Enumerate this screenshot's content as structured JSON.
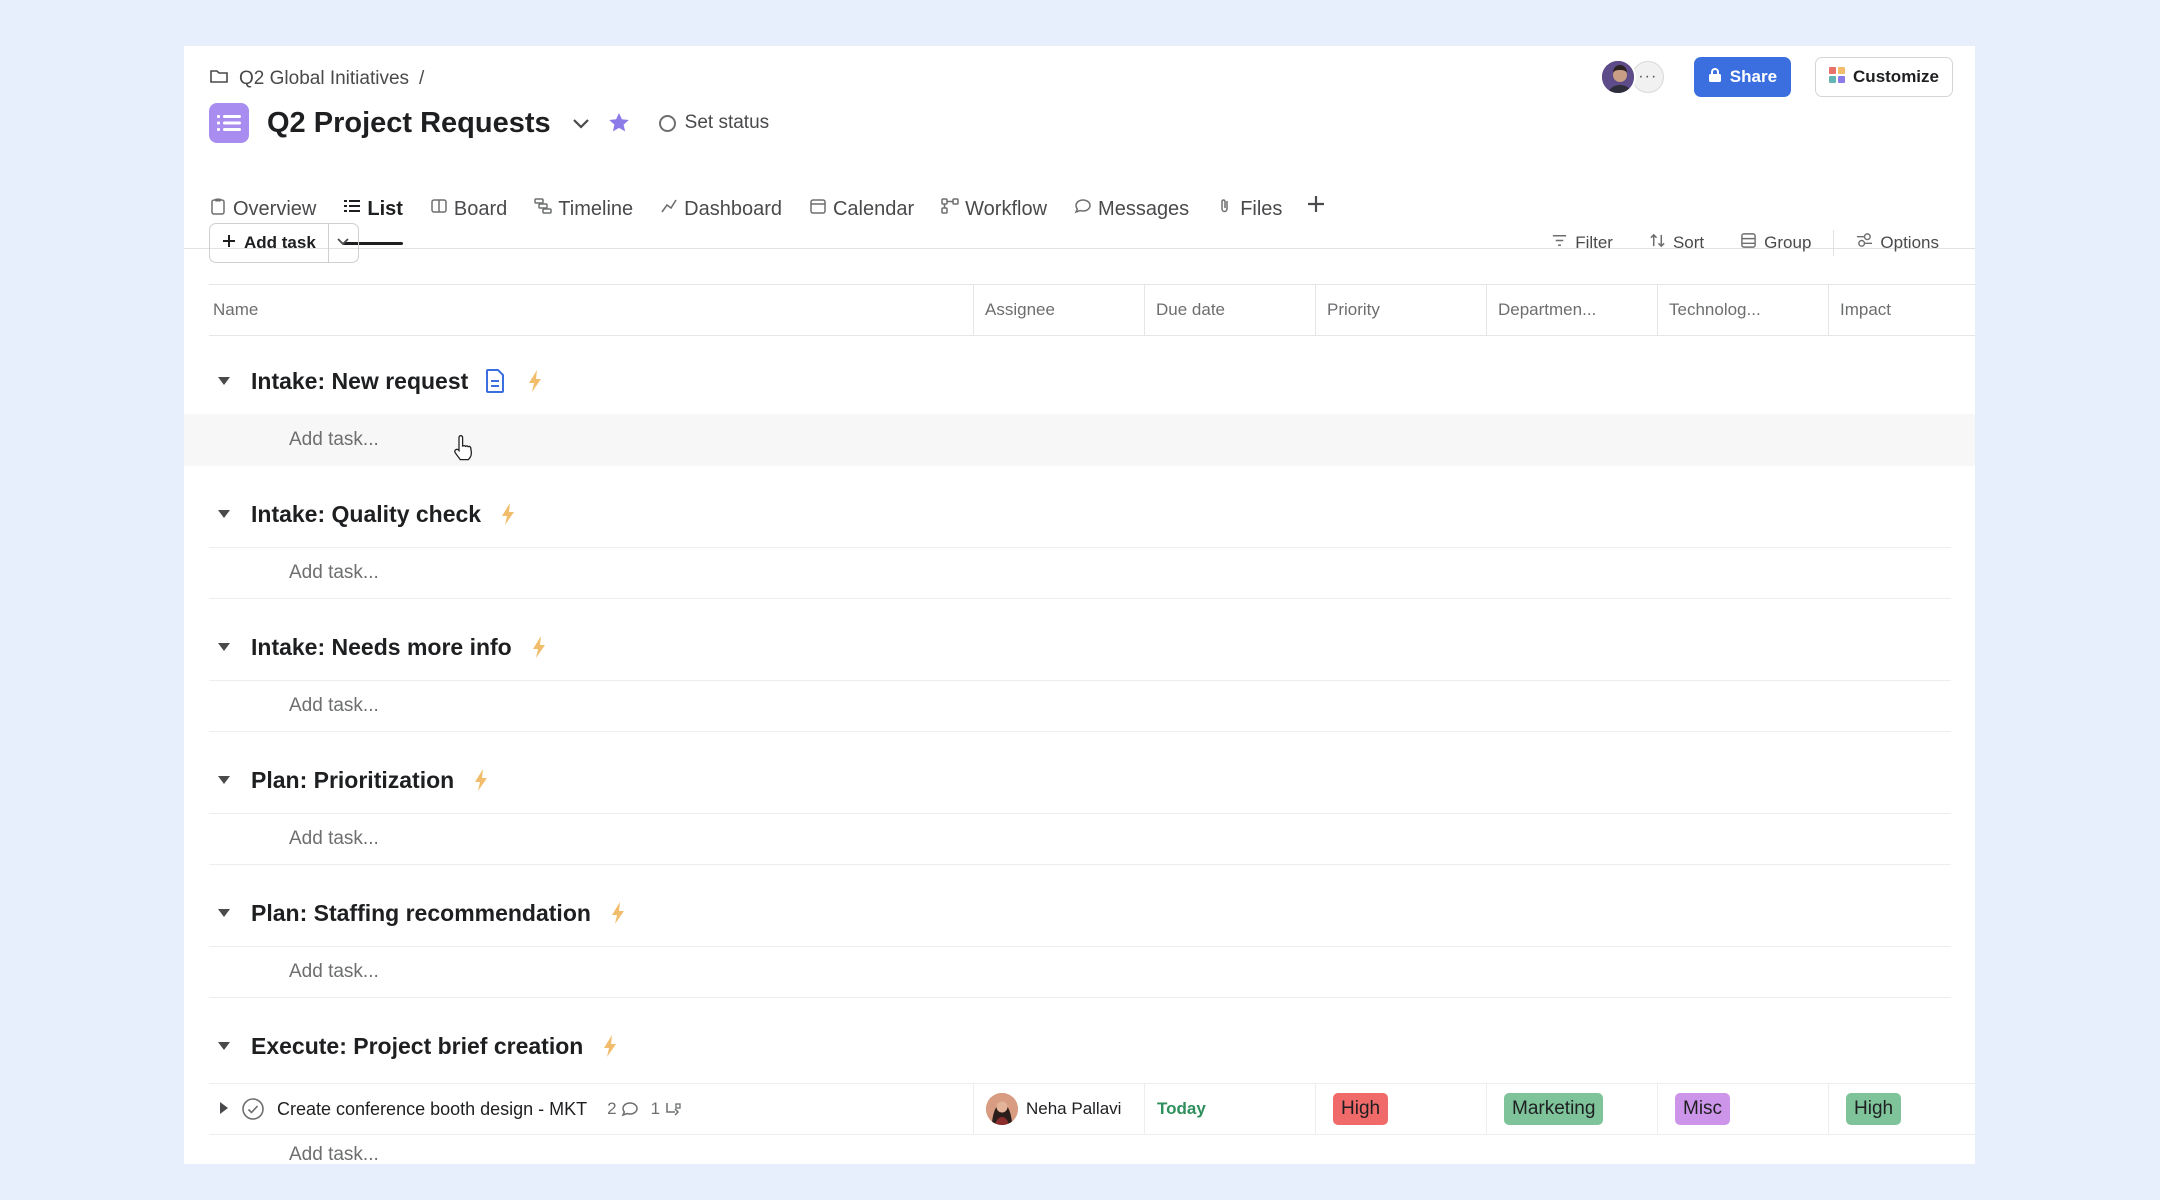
{
  "breadcrumb": {
    "parent": "Q2 Global Initiatives",
    "separator": "/"
  },
  "project": {
    "title": "Q2 Project Requests",
    "set_status": "Set status"
  },
  "header_actions": {
    "more_glyph": "···",
    "share": "Share",
    "customize": "Customize"
  },
  "tabs": [
    {
      "label": "Overview",
      "icon": "clipboard-icon"
    },
    {
      "label": "List",
      "icon": "list-icon",
      "active": true
    },
    {
      "label": "Board",
      "icon": "board-icon"
    },
    {
      "label": "Timeline",
      "icon": "timeline-icon"
    },
    {
      "label": "Dashboard",
      "icon": "dashboard-icon"
    },
    {
      "label": "Calendar",
      "icon": "calendar-icon"
    },
    {
      "label": "Workflow",
      "icon": "workflow-icon"
    },
    {
      "label": "Messages",
      "icon": "message-icon"
    },
    {
      "label": "Files",
      "icon": "paperclip-icon"
    }
  ],
  "toolbar": {
    "add_task": "Add task",
    "filter": "Filter",
    "sort": "Sort",
    "group": "Group",
    "options": "Options"
  },
  "columns": [
    "Name",
    "Assignee",
    "Due date",
    "Priority",
    "Departmen...",
    "Technolog...",
    "Impact"
  ],
  "sections": [
    {
      "title": "Intake: New request",
      "add_task": "Add task..."
    },
    {
      "title": "Intake: Quality check",
      "add_task": "Add task..."
    },
    {
      "title": "Intake: Needs more info",
      "add_task": "Add task..."
    },
    {
      "title": "Plan: Prioritization",
      "add_task": "Add task..."
    },
    {
      "title": "Plan: Staffing recommendation",
      "add_task": "Add task..."
    },
    {
      "title": "Execute: Project brief creation",
      "add_task": "Add task..."
    }
  ],
  "task": {
    "name": "Create conference booth design - MKT",
    "comments": "2",
    "subtasks": "1",
    "assignee": "Neha Pallavi",
    "due": "Today",
    "priority": "High",
    "department": "Marketing",
    "technology": "Misc",
    "impact": "High"
  },
  "colors": {
    "background": "#e8effc",
    "share_button": "#3b6fe0",
    "project_icon": "#a98cf0",
    "bolt": "#f1bd6c",
    "due_today": "#2f8f5c",
    "priority_high": "#f06a6a",
    "department_marketing": "#7ec39a",
    "technology_misc": "#cd95ea",
    "impact_high": "#7ec39a"
  }
}
